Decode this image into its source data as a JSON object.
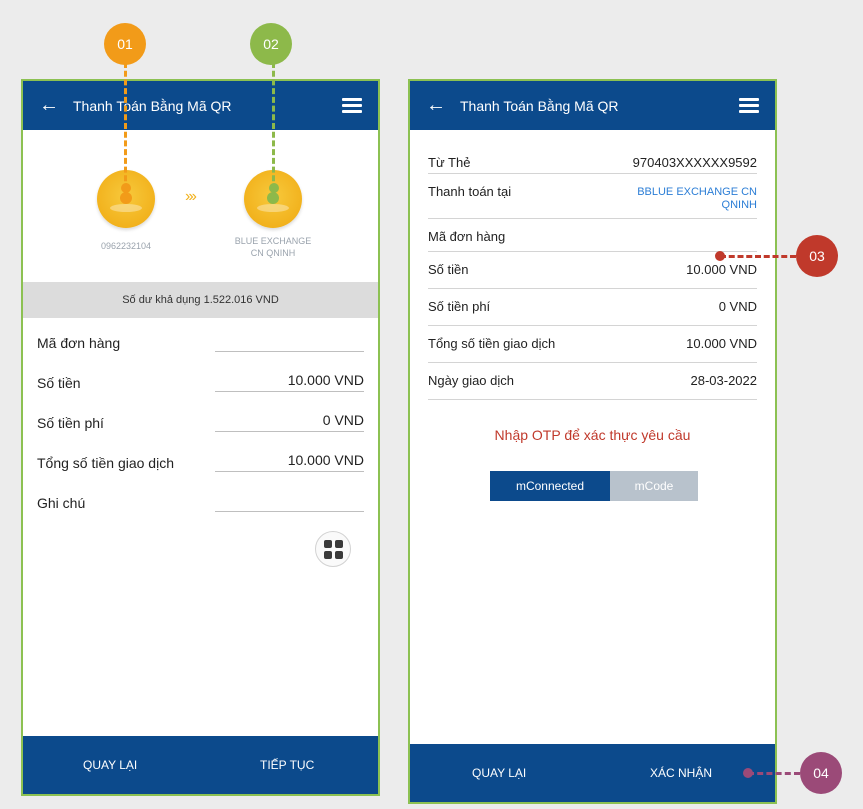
{
  "colors": {
    "header_blue": "#0c4a8c",
    "phone_border": "#8cc152",
    "coin": "#f2b21d",
    "callout_01": "#f29b19",
    "callout_02": "#8db94a",
    "callout_03": "#c0392b",
    "callout_04": "#9b4a78",
    "otp_text": "#c0392b"
  },
  "callouts": [
    "01",
    "02",
    "03",
    "04"
  ],
  "screen1": {
    "title": "Thanh Toán Bằng Mã QR",
    "back_icon": "back-arrow-icon",
    "menu_icon": "hamburger-menu-icon",
    "from_account": "0962232104",
    "to_merchant_line1": "BLUE EXCHANGE",
    "to_merchant_line2": "CN QNINH",
    "arrow_glyph": "›››",
    "balance": "Số dư khả dụng  1.522.016 VND",
    "fields": [
      {
        "label": "Mã đơn hàng",
        "value": ""
      },
      {
        "label": "Số tiền",
        "value": "10.000  VND"
      },
      {
        "label": "Số tiền phí",
        "value": "0 VND"
      },
      {
        "label": "Tổng số tiền giao dịch",
        "value": "10.000 VND"
      },
      {
        "label": "Ghi chú",
        "value": ""
      }
    ],
    "qr_icon": "qr-grid-icon",
    "back_button": "QUAY LẠI",
    "next_button": "TIẾP TỤC"
  },
  "screen2": {
    "title": "Thanh Toán Bằng Mã QR",
    "back_icon": "back-arrow-icon",
    "menu_icon": "hamburger-menu-icon",
    "rows": [
      {
        "label": "Từ Thẻ",
        "value": "970403XXXXXX9592"
      },
      {
        "label": "Thanh toán tại",
        "value": "BBLUE EXCHANGE CN QNINH"
      },
      {
        "label": "Mã đơn hàng",
        "value": ""
      },
      {
        "label": "Số tiền",
        "value": "10.000 VND"
      },
      {
        "label": "Số tiền phí",
        "value": "0 VND"
      },
      {
        "label": "Tổng số tiền giao dịch",
        "value": "10.000 VND"
      },
      {
        "label": "Ngày giao dịch",
        "value": "28-03-2022"
      }
    ],
    "otp_prompt": "Nhập OTP để xác thực yêu cầu",
    "otp_options": [
      "mConnected",
      "mCode"
    ],
    "otp_selected": "mConnected",
    "back_button": "QUAY LẠI",
    "confirm_button": "XÁC NHẬN"
  }
}
